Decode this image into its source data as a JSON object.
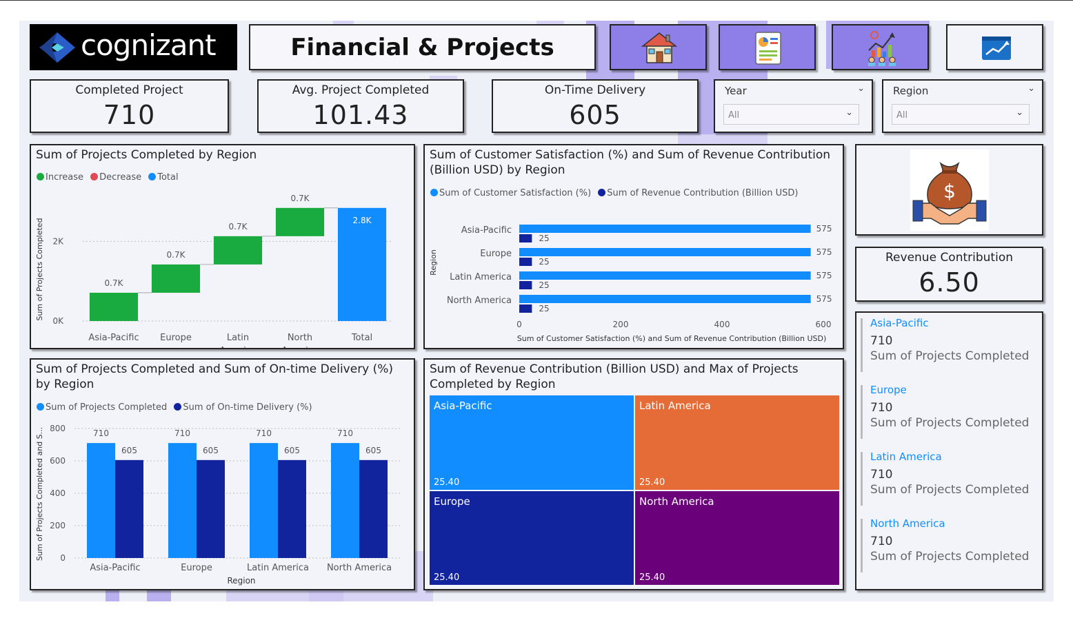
{
  "header": {
    "logo_text": "cognizant",
    "title": "Financial & Projects"
  },
  "nav": {
    "icons": [
      "home-icon",
      "report-icon",
      "analytics-people-icon",
      "trend-chart-icon"
    ]
  },
  "kpis": {
    "completed": {
      "label": "Completed Project",
      "value": "710"
    },
    "avg_completed": {
      "label": "Avg. Project Completed",
      "value": "101.43"
    },
    "on_time": {
      "label": "On-Time Delivery",
      "value": "605"
    },
    "revenue": {
      "label": "Revenue Contribution",
      "value": "6.50"
    }
  },
  "slicers": {
    "year": {
      "label": "Year",
      "value": "All"
    },
    "region": {
      "label": "Region",
      "value": "All"
    }
  },
  "chart_data": [
    {
      "type": "bar",
      "subtype": "waterfall",
      "title": "Sum of Projects Completed by Region",
      "legend": [
        "Increase",
        "Decrease",
        "Total"
      ],
      "legend_colors": [
        "#1aab40",
        "#e04a55",
        "#118dff"
      ],
      "categories": [
        "Asia-Pacific",
        "Europe",
        "Latin America",
        "North America",
        "Total"
      ],
      "values": [
        710,
        710,
        710,
        710,
        2840
      ],
      "data_labels": [
        "0.7K",
        "0.7K",
        "0.7K",
        "0.7K",
        "2.8K"
      ],
      "xlabel": "Region",
      "ylabel": "Sum of Projects Completed",
      "y_ticks": [
        "0K",
        "2K"
      ],
      "ylim": [
        0,
        3200
      ]
    },
    {
      "type": "bar",
      "orientation": "horizontal",
      "title": "Sum of Customer Satisfaction (%) and Sum of Revenue Contribution (Billion USD) by Region",
      "categories": [
        "Asia-Pacific",
        "Europe",
        "Latin America",
        "North America"
      ],
      "series": [
        {
          "name": "Sum of Customer Satisfaction (%)",
          "values": [
            575,
            575,
            575,
            575
          ],
          "color": "#118dff"
        },
        {
          "name": "Sum of Revenue Contribution (Billion USD)",
          "values": [
            25,
            25,
            25,
            25
          ],
          "color": "#12239e"
        }
      ],
      "xlabel": "Sum of Customer Satisfaction (%) and Sum of Revenue Contribution (Billion USD)",
      "ylabel": "Region",
      "x_ticks": [
        0,
        200,
        400,
        600
      ],
      "xlim": [
        0,
        600
      ]
    },
    {
      "type": "bar",
      "title": "Sum of Projects Completed and Sum of On-time Delivery (%) by Region",
      "categories": [
        "Asia-Pacific",
        "Europe",
        "Latin America",
        "North America"
      ],
      "series": [
        {
          "name": "Sum of Projects Completed",
          "values": [
            710,
            710,
            710,
            710
          ],
          "color": "#118dff"
        },
        {
          "name": "Sum of On-time Delivery (%)",
          "values": [
            605,
            605,
            605,
            605
          ],
          "color": "#12239e"
        }
      ],
      "xlabel": "Region",
      "ylabel": "Sum of Projects Completed and S...",
      "y_ticks": [
        0,
        200,
        400,
        600,
        800
      ],
      "ylim": [
        0,
        800
      ]
    },
    {
      "type": "heatmap",
      "subtype": "treemap",
      "title": "Sum of Revenue Contribution (Billion USD) and Max of Projects Completed by Region",
      "categories": [
        "Asia-Pacific",
        "Latin America",
        "Europe",
        "North America"
      ],
      "values": [
        25.4,
        25.4,
        25.4,
        25.4
      ],
      "value_labels": [
        "25.40",
        "25.40",
        "25.40",
        "25.40"
      ],
      "colors": [
        "#118dff",
        "#e66c37",
        "#12239e",
        "#6b007b"
      ]
    }
  ],
  "multi_card": [
    {
      "region": "Asia-Pacific",
      "value": "710",
      "label": "Sum of Projects Completed"
    },
    {
      "region": "Europe",
      "value": "710",
      "label": "Sum of Projects Completed"
    },
    {
      "region": "Latin America",
      "value": "710",
      "label": "Sum of Projects Completed"
    },
    {
      "region": "North America",
      "value": "710",
      "label": "Sum of Projects Completed"
    }
  ]
}
